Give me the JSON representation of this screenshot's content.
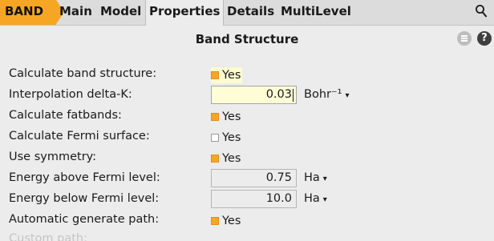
{
  "tabs": {
    "badge": "BAND",
    "items": [
      "Main",
      "Model",
      "Properties",
      "Details",
      "MultiLevel"
    ],
    "active": "Properties"
  },
  "section": {
    "title": "Band Structure",
    "help_glyph": "?"
  },
  "form": {
    "calculate_band_structure": {
      "label": "Calculate band structure:",
      "value": "Yes",
      "checked": true
    },
    "interpolation_delta_k": {
      "label": "Interpolation delta-K:",
      "value": "0.03",
      "unit": "Bohr⁻¹",
      "caret": "▾"
    },
    "calculate_fatbands": {
      "label": "Calculate fatbands:",
      "value": "Yes",
      "checked": true
    },
    "calculate_fermi_surface": {
      "label": "Calculate Fermi surface:",
      "value": "Yes",
      "checked": false
    },
    "use_symmetry": {
      "label": "Use symmetry:",
      "value": "Yes",
      "checked": true
    },
    "energy_above_fermi": {
      "label": "Energy above Fermi level:",
      "value": "0.75",
      "unit": "Ha",
      "caret": "▾"
    },
    "energy_below_fermi": {
      "label": "Energy below Fermi level:",
      "value": "10.0",
      "unit": "Ha",
      "caret": "▾"
    },
    "automatic_generate_path": {
      "label": "Automatic generate path:",
      "value": "Yes",
      "checked": true
    },
    "custom_path": {
      "label": "Custom path:"
    }
  },
  "colors": {
    "accent": "#f7a624",
    "field_highlight": "#fefdd6",
    "background": "#ececec"
  },
  "icons": {
    "search": "search-icon",
    "menu": "menu-icon",
    "help": "help-icon"
  }
}
